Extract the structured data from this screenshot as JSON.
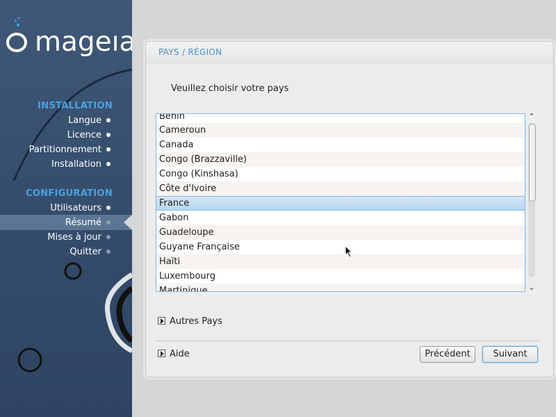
{
  "brand": {
    "logo_text": "mageıa",
    "logo_icon": "mageia-cauldron-icon"
  },
  "sidebar": {
    "installation_title": "INSTALLATION",
    "installation_steps": [
      "Langue",
      "Licence",
      "Partitionnement",
      "Installation"
    ],
    "configuration_title": "CONFIGURATION",
    "configuration_steps": [
      "Utilisateurs",
      "Résumé",
      "Mises à jour",
      "Quitter"
    ],
    "current_step": "Résumé"
  },
  "page": {
    "title": "PAYS / RÉGION",
    "prompt": "Veuillez choisir votre pays"
  },
  "countries": {
    "items": [
      "Bénin",
      "Cameroun",
      "Canada",
      "Congo (Brazzaville)",
      "Congo (Kinshasa)",
      "Côte d'Ivoire",
      "France",
      "Gabon",
      "Guadeloupe",
      "Guyane Française",
      "Haïti",
      "Luxembourg",
      "Martinique"
    ],
    "selected": "France"
  },
  "expanders": {
    "other_countries": "Autres Pays",
    "help": "Aide"
  },
  "buttons": {
    "previous": "Précédent",
    "next": "Suivant"
  },
  "colors": {
    "accent": "#46a3e0",
    "sidebar_bg": "#3a5270",
    "selection": "#b9d6ef"
  }
}
